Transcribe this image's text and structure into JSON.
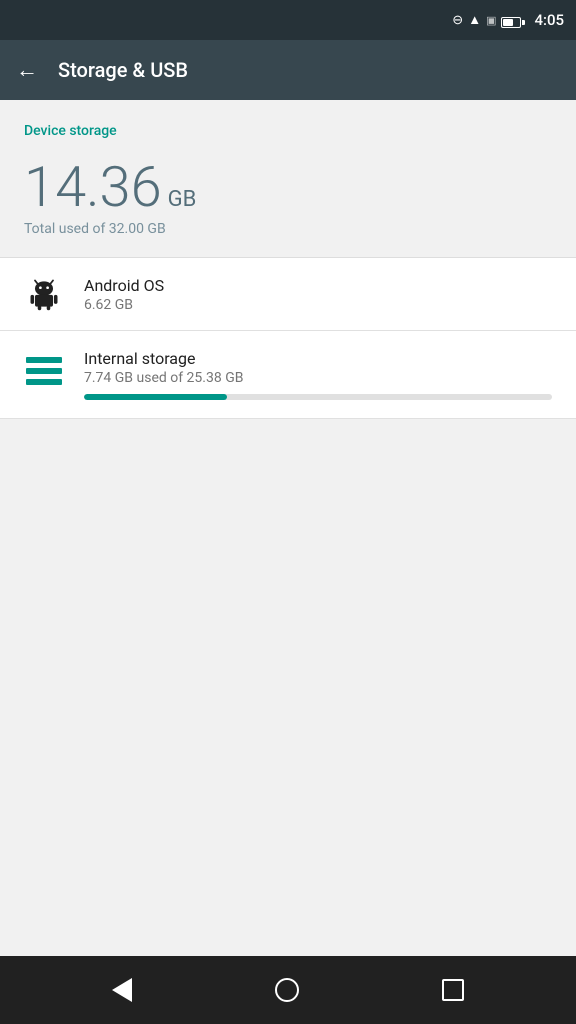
{
  "statusBar": {
    "time": "4:05"
  },
  "toolbar": {
    "backLabel": "←",
    "title": "Storage & USB"
  },
  "deviceStorage": {
    "sectionLabel": "Device storage",
    "usedAmount": "14.36",
    "usedUnit": "GB",
    "totalText": "Total used of 32.00 GB"
  },
  "items": [
    {
      "id": "android-os",
      "title": "Android OS",
      "subtitle": "6.62 GB",
      "iconType": "android",
      "hasProgress": false
    },
    {
      "id": "internal-storage",
      "title": "Internal storage",
      "subtitle": "7.74 GB used of 25.38 GB",
      "iconType": "storage-lines",
      "hasProgress": true,
      "progressPercent": 30.5
    }
  ],
  "navBar": {
    "backLabel": "back",
    "homeLabel": "home",
    "recentLabel": "recent"
  },
  "colors": {
    "accent": "#009688",
    "toolbarBg": "#37474f",
    "statusBg": "#263238"
  }
}
